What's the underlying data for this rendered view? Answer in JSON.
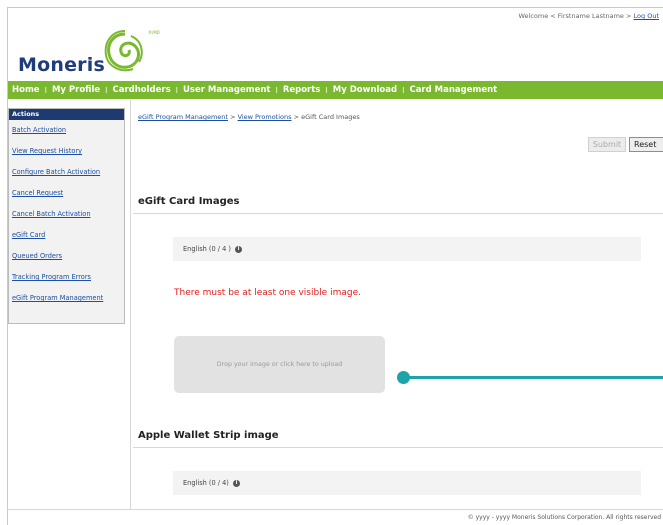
{
  "header": {
    "welcome": "Welcome < Firstname Lastname >",
    "logout_label": "Log Out",
    "logo_text": "Moneris",
    "logo_mark": "®/MD"
  },
  "nav": {
    "items": [
      "Home",
      "My Profile",
      "Cardholders",
      "User Management",
      "Reports",
      "My Download",
      "Card Management"
    ],
    "separator": "I"
  },
  "sidebar": {
    "heading": "Actions",
    "items": [
      {
        "label": "Batch Activation"
      },
      {
        "label": "View Request History"
      },
      {
        "label": "Configure Batch Activation"
      },
      {
        "label": "Cancel Request"
      },
      {
        "label": "Cancel Batch Activation"
      },
      {
        "label": "eGift Card"
      },
      {
        "label": "Queued Orders"
      },
      {
        "label": "Tracking Program Errors"
      },
      {
        "label": "eGift Program Management"
      }
    ]
  },
  "breadcrumb": {
    "crumb1": "eGift Program Management",
    "sep1": ">",
    "crumb2": "View Promotions",
    "sep2": ">",
    "current": "eGift Card Images"
  },
  "toolbar": {
    "submit_label": "Submit",
    "reset_label": "Reset"
  },
  "egift_images": {
    "title": "eGift Card Images",
    "language_label": "English (0 / 4 )",
    "error": "There must be at least one visible image.",
    "dropzone_text": "Drop your image or click here to upload"
  },
  "wallet": {
    "title": "Apple Wallet Strip image",
    "language_label": "English (0 / 4)"
  },
  "footer": {
    "copyright": "© yyyy - yyyy  Moneris Solutions Corporation. All rights reserved"
  },
  "colors": {
    "brand_green": "#7ab830",
    "brand_navy": "#1f3a6e",
    "error_red": "#e02020",
    "slider_teal": "#1ea3a8"
  }
}
